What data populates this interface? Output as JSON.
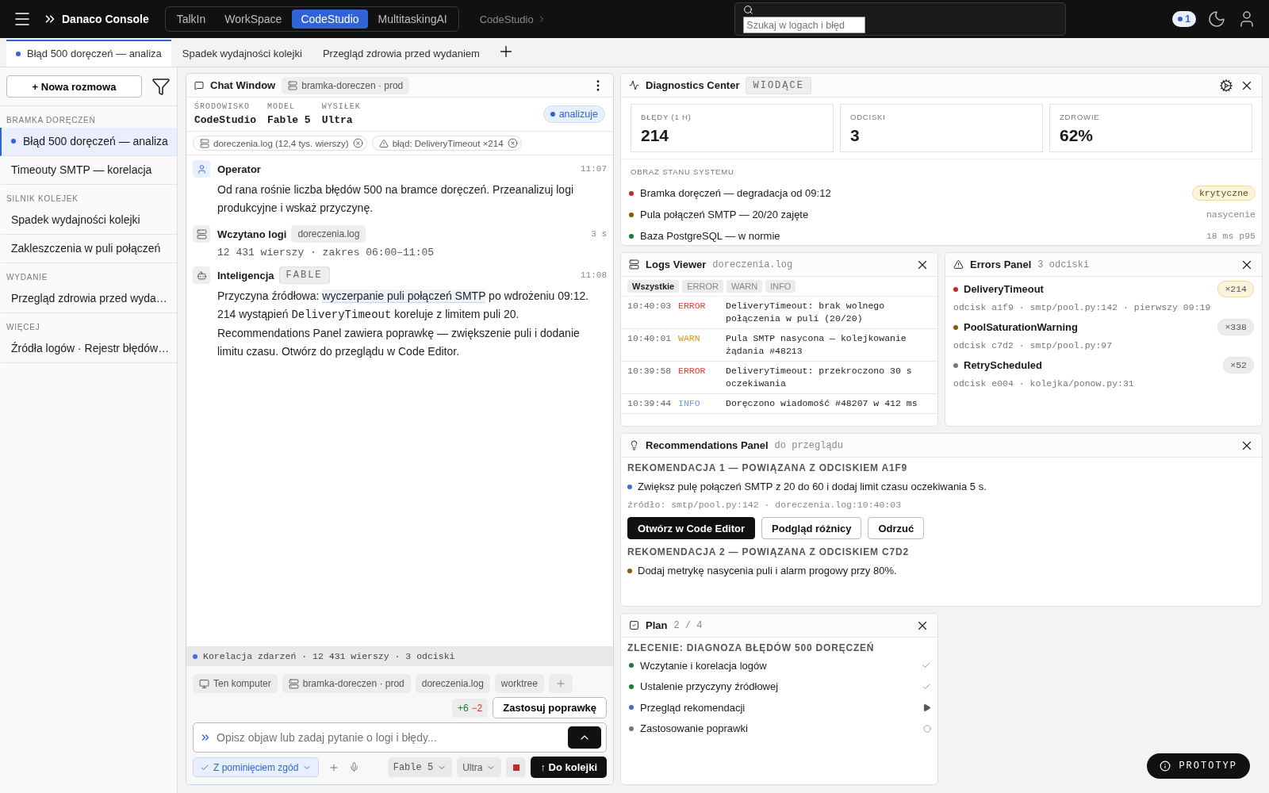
{
  "topbar": {
    "brand": "Danaco Console",
    "apps": [
      {
        "label": "TalkIn",
        "selected": false
      },
      {
        "label": "WorkSpace",
        "selected": false
      },
      {
        "label": "CodeStudio",
        "selected": true
      },
      {
        "label": "MultitaskingAI",
        "selected": false
      }
    ],
    "breadcrumb": "CodeStudio",
    "search": {
      "placeholder": "Szukaj w logach i błęd"
    },
    "notifications": "1"
  },
  "tabs": [
    {
      "label": "Błąd 500 doręczeń — analiza",
      "selected": true
    },
    {
      "label": "Spadek wydajności kolejki",
      "selected": false
    },
    {
      "label": "Przegląd zdrowia przed wydaniem",
      "selected": false
    }
  ],
  "sidebar": {
    "new_button": "+ Nowa rozmowa",
    "groups": [
      {
        "title": "BRAMKA DORĘCZEŃ",
        "items": [
          {
            "label": "Błąd 500 doręczeń — analiza",
            "selected": true
          },
          {
            "label": "Timeouty SMTP — korelacja",
            "selected": false
          }
        ]
      },
      {
        "title": "SILNIK KOLEJEK",
        "items": [
          {
            "label": "Spadek wydajności kolejki",
            "selected": false
          },
          {
            "label": "Zakleszczenia w puli połączeń",
            "selected": false
          }
        ]
      },
      {
        "title": "WYDANIE",
        "items": [
          {
            "label": "Przegląd zdrowia przed wyda…",
            "selected": false
          }
        ]
      },
      {
        "title": "WIĘCEJ",
        "items": [
          {
            "label": "Źródła logów · Rejestr błędów…",
            "selected": false
          }
        ]
      }
    ]
  },
  "chat": {
    "title": "Chat Window",
    "env_chip": "bramka-doreczen · prod",
    "meta": [
      {
        "label": "ŚRODOWISKO",
        "value": "CodeStudio"
      },
      {
        "label": "MODEL",
        "value": "Fable 5"
      },
      {
        "label": "WYSIŁEK",
        "value": "Ultra"
      }
    ],
    "status": "analizuje",
    "attachments": [
      {
        "kind": "file",
        "label": "doreczenia.log (12,4 tys. wierszy)"
      },
      {
        "kind": "error",
        "label": "błąd: DeliveryTimeout ×214"
      }
    ],
    "messages": [
      {
        "kind": "user",
        "author": "Operator",
        "time": "11:07",
        "parts": [
          {
            "kind": "plain",
            "text": "Od rana rośnie liczba błędów 500 na bramce doręczeń. Przeanalizuj logi produkcyjne i wskaż przyczynę."
          }
        ]
      },
      {
        "kind": "tool",
        "author": "Wczytano logi",
        "chip": "doreczenia.log",
        "time": "3 s",
        "detail": "12 431 wierszy · zakres 06:00–11:05"
      },
      {
        "kind": "assistant",
        "author": "Inteligencja",
        "badge": "FABLE",
        "time": "11:08",
        "parts": [
          {
            "kind": "plain",
            "text": "Przyczyna źródłowa: "
          },
          {
            "kind": "highlight",
            "text": "wyczerpanie puli połączeń SMTP"
          },
          {
            "kind": "plain",
            "text": " po wdrożeniu 09:12. 214 wystąpień "
          },
          {
            "kind": "code",
            "text": "DeliveryTimeout"
          },
          {
            "kind": "plain",
            "text": " koreluje z limitem puli 20. Recommendations Panel zawiera poprawkę — zwiększenie puli i dodanie limitu czasu. Otwórz do przeglądu w Code Editor."
          }
        ]
      }
    ],
    "activity": "Korelacja zdarzeń · 12 431 wierszy · 3 odciski",
    "context_chips": [
      {
        "kind": "computer",
        "label": "Ten komputer"
      },
      {
        "kind": "server",
        "label": "bramka-doreczen · prod"
      },
      {
        "kind": "plain",
        "label": "doreczenia.log"
      },
      {
        "kind": "plain",
        "label": "worktree"
      }
    ],
    "diff": {
      "added": "+6",
      "removed": "−2"
    },
    "apply_button": "Zastosuj poprawkę",
    "input": {
      "placeholder": "Opisz objaw lub zadaj pytanie o logi i błędy..."
    },
    "mode": "Z pominięciem zgód",
    "model_select": "Fable 5",
    "effort_select": "Ultra",
    "send_button": "↑ Do kolejki"
  },
  "diagnostics": {
    "title": "Diagnostics Center",
    "badge": "WIODĄCE",
    "stats": [
      {
        "label": "BŁĘDY (1 H)",
        "value": "214"
      },
      {
        "label": "ODCISKI",
        "value": "3"
      },
      {
        "label": "ZDROWIE",
        "value": "62%"
      }
    ],
    "section": "OBRAZ STANU SYSTEMU",
    "items": [
      {
        "text": "Bramka doręczeń — degradacja od 09:12",
        "color": "#c62828",
        "kind": "badge",
        "tag": "krytyczne"
      },
      {
        "text": "Pula połączeń SMTP — 20/20 zajęte",
        "color": "#8a5a00",
        "kind": "note",
        "tag": "nasycenie"
      },
      {
        "text": "Baza PostgreSQL — w normie",
        "color": "#1b7a3a",
        "kind": "note",
        "tag": "18 ms p95"
      }
    ]
  },
  "logs": {
    "title": "Logs Viewer",
    "file": "doreczenia.log",
    "filters": [
      {
        "label": "Wszystkie",
        "selected": true
      },
      {
        "label": "ERROR",
        "selected": false
      },
      {
        "label": "WARN",
        "selected": false
      },
      {
        "label": "INFO",
        "selected": false
      }
    ],
    "rows": [
      {
        "time": "10:40:03",
        "level": "ERROR",
        "message": "DeliveryTimeout: brak wolnego połączenia w puli (20/20)"
      },
      {
        "time": "10:40:01",
        "level": "WARN",
        "message": "Pula SMTP nasycona — kolejkowanie żądania #48213"
      },
      {
        "time": "10:39:58",
        "level": "ERROR",
        "message": "DeliveryTimeout: przekroczono 30 s oczekiwania"
      },
      {
        "time": "10:39:44",
        "level": "INFO",
        "message": "Doręczono wiadomość #48207 w 412 ms"
      }
    ]
  },
  "errors": {
    "title": "Errors Panel",
    "count": "3 odciski",
    "items": [
      {
        "name": "DeliveryTimeout",
        "color": "#c62828",
        "kind": "critical",
        "count": "×214",
        "detail": "odcisk a1f9 · smtp/pool.py:142 · pierwszy 09:19"
      },
      {
        "name": "PoolSaturationWarning",
        "color": "#8a5a00",
        "kind": "normal",
        "count": "×338",
        "detail": "odcisk c7d2 · smtp/pool.py:97"
      },
      {
        "name": "RetryScheduled",
        "color": "#777777",
        "kind": "normal",
        "count": "×52",
        "detail": "odcisk e004 · kolejka/ponow.py:31"
      }
    ]
  },
  "recommendations": {
    "title": "Recommendations Panel",
    "status": "do przeglądu",
    "items": [
      {
        "heading": "REKOMENDACJA 1 — POWIĄZANA Z ODCISKIEM A1F9",
        "text": "Zwiększ pulę połączeń SMTP z 20 do 60 i dodaj limit czasu oczekiwania 5 s.",
        "color": "#3b6fd8",
        "source": "źródło: smtp/pool.py:142 · doreczenia.log:10:40:03",
        "actions": [
          {
            "label": "Otwórz w Code Editor",
            "kind": "primary"
          },
          {
            "label": "Podgląd różnicy",
            "kind": "secondary"
          },
          {
            "label": "Odrzuć",
            "kind": "secondary"
          }
        ]
      },
      {
        "heading": "REKOMENDACJA 2 — POWIĄZANA Z ODCISKIEM C7D2",
        "text": "Dodaj metrykę nasycenia puli i alarm progowy przy 80%.",
        "color": "#8a5a00"
      }
    ]
  },
  "plan": {
    "title": "Plan",
    "progress": "2 / 4",
    "heading": "ZLECENIE: DIAGNOZA BŁĘDÓW 500 DORĘCZEŃ",
    "steps": [
      {
        "label": "Wczytanie i korelacja logów",
        "kind": "done"
      },
      {
        "label": "Ustalenie przyczyny źródłowej",
        "kind": "done"
      },
      {
        "label": "Przegląd rekomendacji",
        "kind": "active"
      },
      {
        "label": "Zastosowanie poprawki",
        "kind": "pending"
      }
    ]
  },
  "prototype_badge": "PROTOTYP"
}
